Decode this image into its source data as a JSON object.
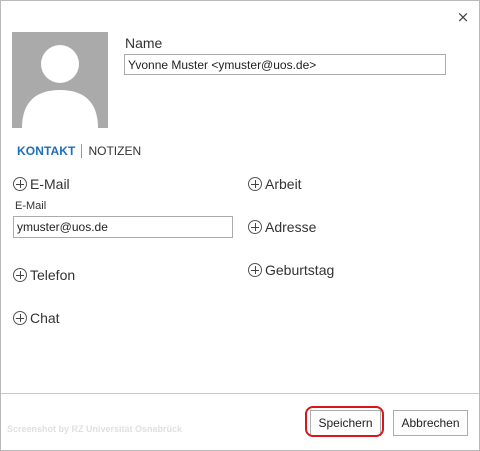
{
  "dialog": {
    "close_glyph": "×"
  },
  "name": {
    "label": "Name",
    "value": "Yvonne Muster <ymuster@uos.de>"
  },
  "tabs": [
    {
      "label": "KONTAKT",
      "active": true
    },
    {
      "label": "NOTIZEN",
      "active": false
    }
  ],
  "left_column": {
    "email_add_label": "E-Mail",
    "email_field_label": "E-Mail",
    "email_value": "ymuster@uos.de",
    "phone_add_label": "Telefon",
    "chat_add_label": "Chat"
  },
  "right_column": {
    "work_add_label": "Arbeit",
    "address_add_label": "Adresse",
    "birthday_add_label": "Geburtstag"
  },
  "footer": {
    "watermark": "Screenshot by RZ Universität Osnabrück",
    "save_label": "Speichern",
    "cancel_label": "Abbrechen"
  },
  "colors": {
    "accent": "#1e6fb5",
    "highlight_ring": "#d8161b",
    "avatar_bg": "#aaaaaa"
  }
}
